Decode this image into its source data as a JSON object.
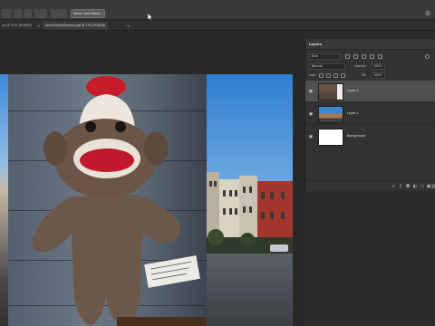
{
  "options_bar": {
    "button_label": "Select and Mask...",
    "icons": [
      "gear-icon"
    ]
  },
  "tabs": [
    {
      "label": "ng @ 25% (RGB/8*)",
      "close": "×"
    },
    {
      "label": "sockmonkeyfactory.jpg @ 25% (RGB/8)",
      "close": "×"
    }
  ],
  "layers_panel": {
    "title": "Layers",
    "kind_filter": "Kind",
    "blend_mode": "Normal",
    "opacity_label": "Opacity:",
    "opacity_value": "100%",
    "lock_label": "Lock:",
    "fill_label": "Fill:",
    "fill_value": "100%",
    "layers": [
      {
        "name": "Layer 2",
        "visible": true,
        "selected": true
      },
      {
        "name": "Layer 1",
        "visible": true,
        "selected": false
      },
      {
        "name": "Background",
        "visible": true,
        "selected": false
      }
    ],
    "footer_icons": [
      "link-icon",
      "fx-icon",
      "mask-icon",
      "adjustment-icon",
      "folder-icon",
      "new-layer-icon",
      "trash-icon"
    ]
  },
  "colors": {
    "panel_bg": "#323232",
    "selected_layer": "#505050",
    "workspace_bg": "#282828"
  }
}
